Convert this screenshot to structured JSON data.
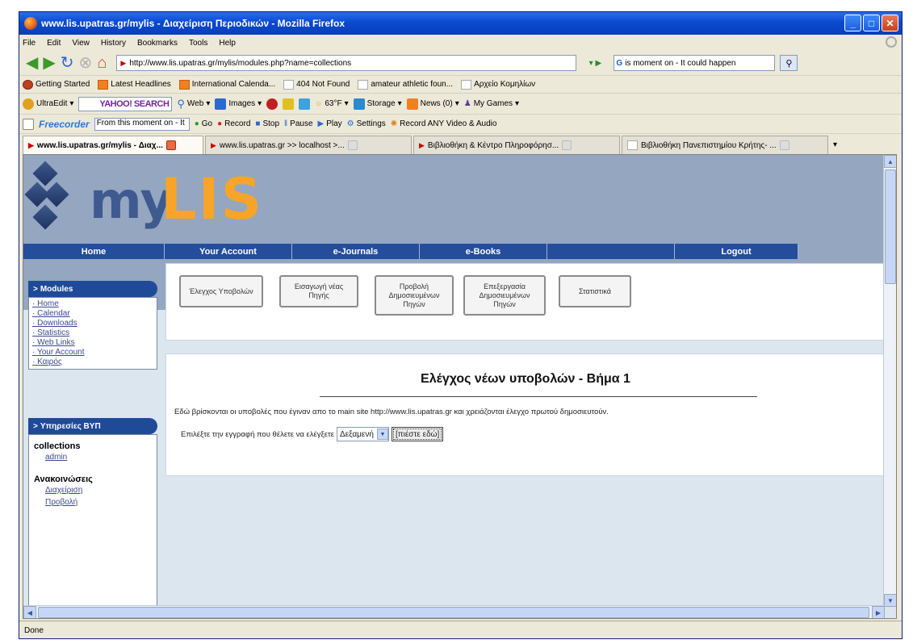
{
  "window": {
    "title": "www.lis.upatras.gr/mylis - Διαχείριση Περιοδικών - Mozilla Firefox"
  },
  "menu": [
    "File",
    "Edit",
    "View",
    "History",
    "Bookmarks",
    "Tools",
    "Help"
  ],
  "address": {
    "url": "http://www.lis.upatras.gr/mylis/modules.php?name=collections"
  },
  "search": {
    "engine": "G",
    "value": "is moment on - It could happen"
  },
  "bookmarks": [
    {
      "label": "Getting Started",
      "icon": "firefox-icon"
    },
    {
      "label": "Latest Headlines",
      "icon": "rss-icon"
    },
    {
      "label": "International Calenda...",
      "icon": "rss-icon"
    },
    {
      "label": "404 Not Found",
      "icon": "page-icon"
    },
    {
      "label": "amateur athletic foun...",
      "icon": "page-icon"
    },
    {
      "label": "Αρχείο Κομηλίων",
      "icon": "page-icon"
    }
  ],
  "toolbar1": {
    "ultraedit": "UltraEdit",
    "yahoo": "YAHOO! SEARCH",
    "web": "Web",
    "images": "Images",
    "weather": "63°F",
    "storage": "Storage",
    "news": "News (0)",
    "games": "My Games"
  },
  "toolbar2": {
    "brand": "Freecorder",
    "input": "From this moment on - It",
    "go": "Go",
    "record": "Record",
    "stop": "Stop",
    "pause": "Pause",
    "play": "Play",
    "settings": "Settings",
    "record_any": "Record ANY Video & Audio"
  },
  "tabs": [
    {
      "label": "www.lis.upatras.gr/mylis - Διαχ...",
      "active": true
    },
    {
      "label": "www.lis.upatras.gr >> localhost >...",
      "active": false
    },
    {
      "label": "Βιβλιοθήκη & Κέντρο Πληροφόρησ...",
      "active": false
    },
    {
      "label": "Βιβλιοθήκη Πανεπιστημίου Κρήτης- ...",
      "active": false
    }
  ],
  "site": {
    "logo_my": "my",
    "logo_lis": "LIS",
    "nav": [
      "Home",
      "Your Account",
      "e-Journals",
      "e-Books",
      "",
      "Logout"
    ]
  },
  "sidebar": {
    "modules_title": "Modules",
    "modules": [
      "Home",
      "Calendar",
      "Downloads",
      "Statistics",
      "Web Links",
      "Your Account",
      "Καιρός"
    ],
    "services_title": "Υπηρεσίες ΒΥΠ",
    "collections": "collections",
    "collections_admin": "admin",
    "announcements": "Ανακοινώσεις",
    "manage": "Διαχείριση",
    "view": "Προβολή"
  },
  "buttons": [
    "Έλεγχος Υποβολών",
    "Εισαγωγή νέας Πηγής",
    "Προβολή Δημοσιευμένων Πηγών",
    "Επεξεργασία Δημοσιευμένων Πηγών",
    "Στατιστικά"
  ],
  "main": {
    "title": "Ελέγχος νέων υποβολών - Βήμα 1",
    "desc": "Εδώ βρίσκονται οι υποβολές που έγιναν απο το main site http://www.lis.upatras.gr και χρειάζονται έλεγχο πρωτού δημοσιευτούν.",
    "select_label": "Επιλέξτε την εγγραφή που θέλετε να ελέγξετε",
    "select_value": "Δεξαμενή",
    "submit": "[πιέστε εδώ]"
  },
  "status": "Done"
}
